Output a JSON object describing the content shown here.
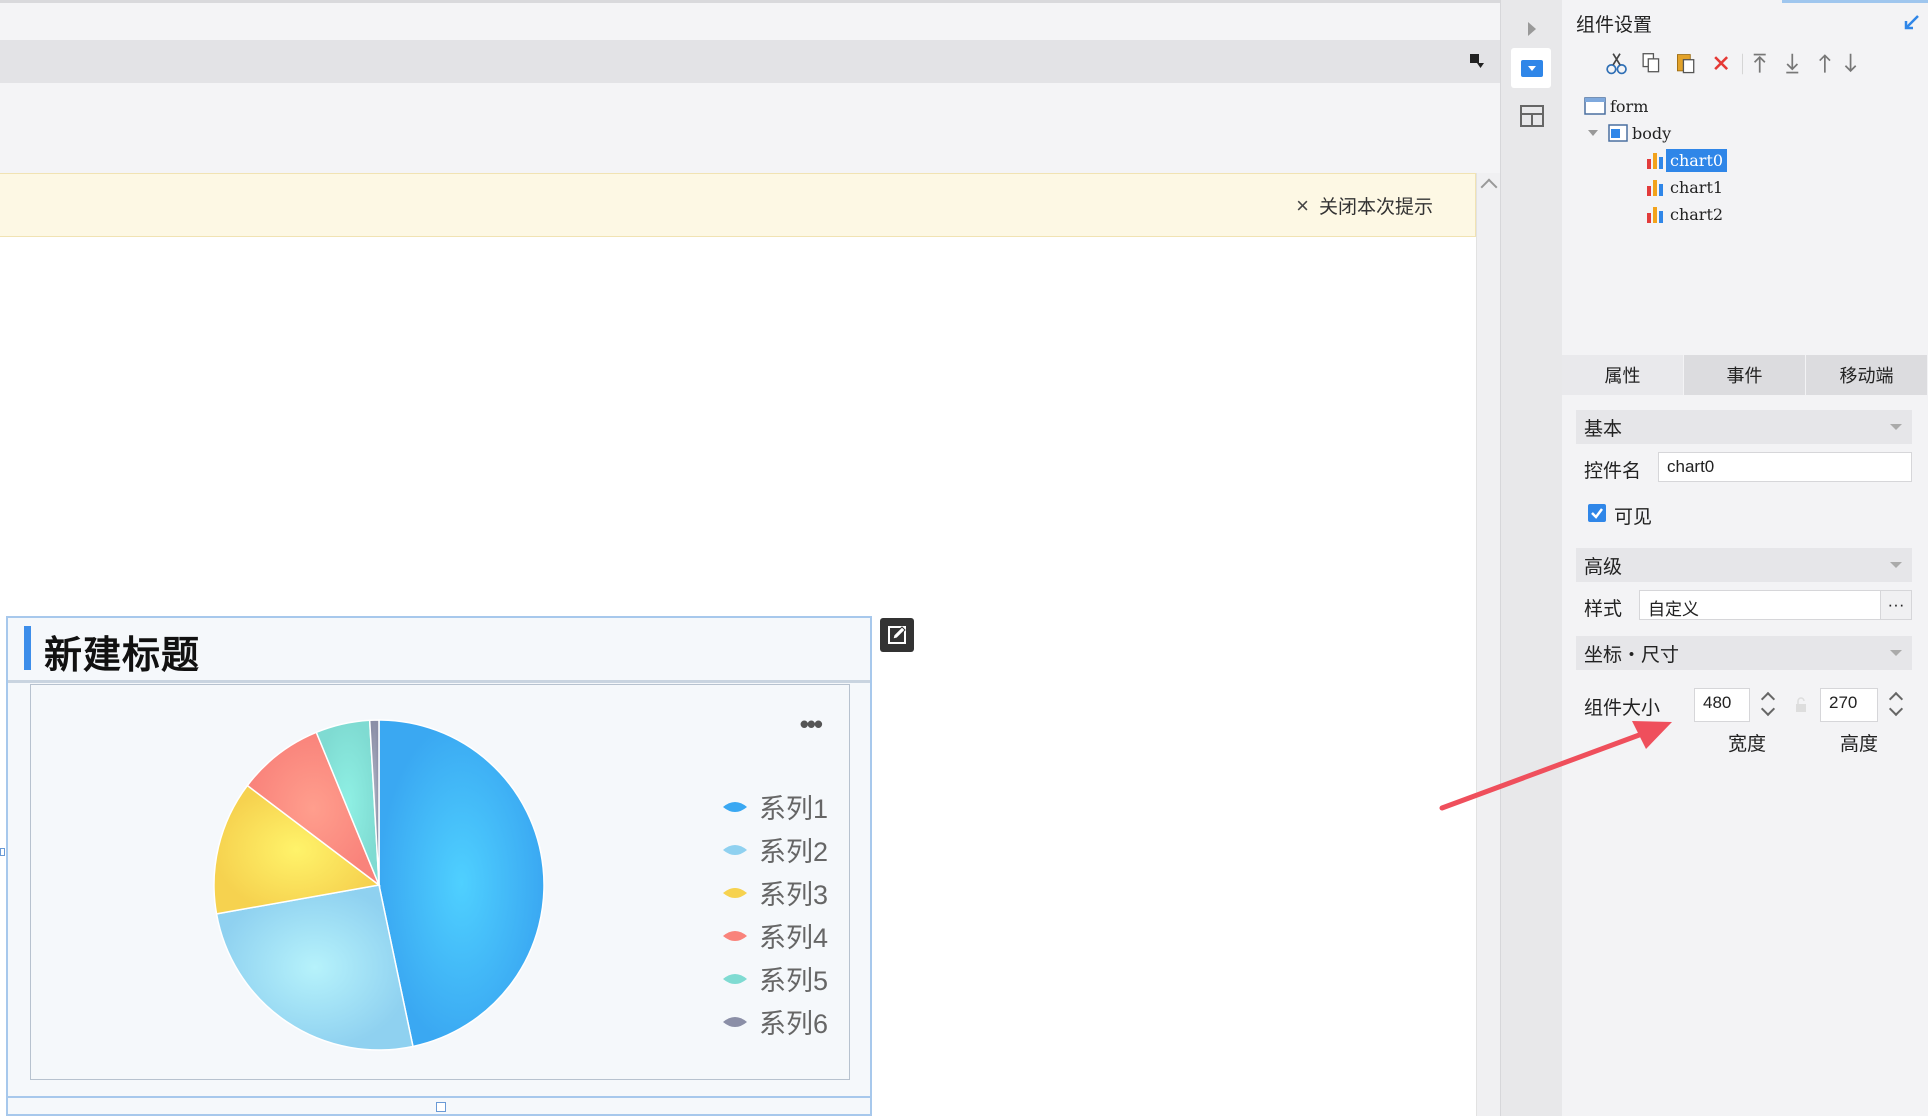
{
  "notice": {
    "close_label": "关闭本次提示"
  },
  "widget": {
    "title": "新建标题",
    "more_label": "•••"
  },
  "chart_data": {
    "type": "pie",
    "series_names": [
      "系列1",
      "系列2",
      "系列3",
      "系列4",
      "系列5",
      "系列6"
    ],
    "values": [
      46.7,
      25.5,
      13.1,
      8.5,
      5.3,
      0.9
    ],
    "colors": [
      "#3aa8f2",
      "#8fd1f0",
      "#f6d24f",
      "#f9837b",
      "#7fdbd2",
      "#8b8fa7"
    ]
  },
  "panel": {
    "title": "组件设置",
    "tree": {
      "form": "form",
      "body": "body",
      "items": [
        "chart0",
        "chart1",
        "chart2"
      ]
    },
    "tabs": [
      "属性",
      "事件",
      "移动端"
    ],
    "sections": {
      "basic": "基本",
      "advanced": "高级",
      "position_size": "坐标・尺寸"
    },
    "control_name_label": "控件名",
    "control_name_value": "chart0",
    "visible_label": "可见",
    "style_label": "样式",
    "style_value": "自定义",
    "style_more": "···",
    "size_label": "组件大小",
    "width_value": "480",
    "height_value": "270",
    "width_label": "宽度",
    "height_label": "高度"
  }
}
